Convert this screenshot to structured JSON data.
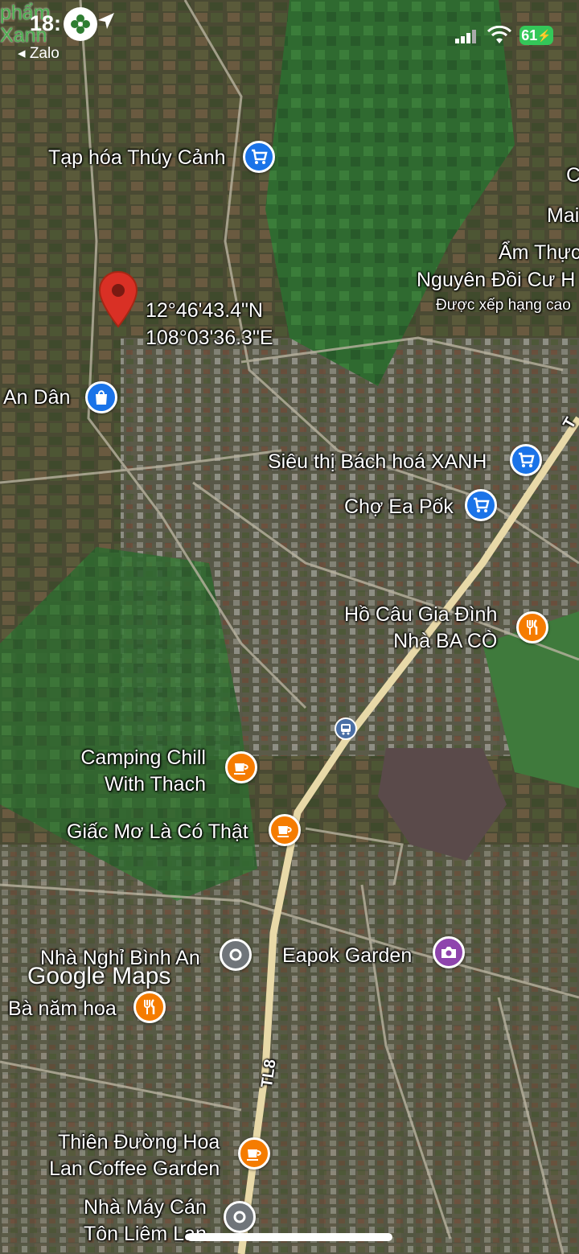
{
  "status_bar": {
    "time": "18:",
    "back_app": "◂ Zalo",
    "battery": "61",
    "overlay_text_line1": "phẩm",
    "overlay_text_line2": "Xanh"
  },
  "pin": {
    "lat": "12°46'43.4\"N",
    "lng": "108°03'36.3\"E"
  },
  "places": [
    {
      "name": "Tạp hóa Thúy Cảnh",
      "type": "shopping-cart"
    },
    {
      "name": "An Dân",
      "type": "shopping-bag"
    },
    {
      "name": "Siêu thị Bách hoá XANH",
      "type": "shopping-cart"
    },
    {
      "name": "Chợ Ea Pốk",
      "type": "shopping-cart"
    },
    {
      "name": "Hồ Câu Gia Đình",
      "name2": "Nhà BA CÒ",
      "type": "restaurant"
    },
    {
      "name": "Camping Chill",
      "name2": "With Thach",
      "type": "cafe"
    },
    {
      "name": "Giấc Mơ Là Có Thật",
      "type": "cafe"
    },
    {
      "name": "Nhà Nghỉ Bình An",
      "type": "place"
    },
    {
      "name": "Eapok Garden",
      "type": "camera"
    },
    {
      "name": "Bà năm hoa",
      "type": "restaurant"
    },
    {
      "name": "Thiên Đường Hoa",
      "name2": "Lan Coffee Garden",
      "type": "cafe"
    },
    {
      "name": "Nhà Máy Cán",
      "name2": "Tôn Liêm Lan",
      "type": "place"
    }
  ],
  "edge_labels": {
    "l1": "Mai",
    "l2": "Ẩm Thực",
    "l3": "Nguyên Đồi Cư H",
    "l4": "Được xếp hạng cao",
    "l5": "C"
  },
  "road_label": "TL8",
  "road_label_top": "T",
  "watermark": "Google Maps",
  "colors": {
    "poi_blue": "#1a73e8",
    "poi_orange": "#f57c00",
    "poi_gray": "#70757a",
    "poi_purple": "#8e44ad",
    "pin_red": "#d93025",
    "road": "#e8d9a8"
  }
}
